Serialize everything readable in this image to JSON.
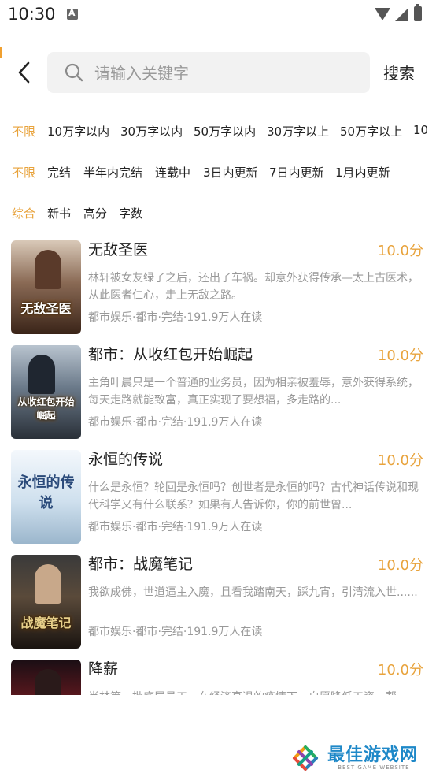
{
  "status_bar": {
    "time": "10:30"
  },
  "header": {
    "search_placeholder": "请输入关键字",
    "search_button": "搜索"
  },
  "filters": {
    "word_count": [
      "不限",
      "10万字以内",
      "30万字以内",
      "50万字以内",
      "30万字以上",
      "50万字以上",
      "10"
    ],
    "status": [
      "不限",
      "完结",
      "半年内完结",
      "连载中",
      "3日内更新",
      "7日内更新",
      "1月内更新"
    ],
    "sort": [
      "综合",
      "新书",
      "高分",
      "字数"
    ]
  },
  "accent_color": "#e8a33c",
  "books": [
    {
      "title": "无敌圣医",
      "score": "10.0分",
      "desc": "林轩被女友绿了之后，还出了车祸。却意外获得传承—太上古医术，从此医者仁心，走上无敌之路。",
      "meta": "都市娱乐·都市·完结·191.9万人在读",
      "cover_text": "无敌圣医"
    },
    {
      "title": "都市：从收红包开始崛起",
      "score": "10.0分",
      "desc": "主角叶晨只是一个普通的业务员，因为相亲被羞辱，意外获得系统，每天走路就能致富，真正实现了要想福，多走路的...",
      "meta": "都市娱乐·都市·完结·191.9万人在读",
      "cover_text": "从收红包开始崛起"
    },
    {
      "title": "永恒的传说",
      "score": "10.0分",
      "desc": "什么是永恒？轮回是永恒吗？创世者是永恒的吗？古代神话传说和现代科学又有什么联系？如果有人告诉你，你的前世曾...",
      "meta": "都市娱乐·都市·完结·191.9万人在读",
      "cover_text": "永恒的传说"
    },
    {
      "title": "都市：战魔笔记",
      "score": "10.0分",
      "desc": "我欲成佛，世道逼主入魔，且看我踏南天，踩九宵，引清流入世......",
      "meta": "都市娱乐·都市·完结·191.9万人在读",
      "cover_text": "战魔笔记"
    },
    {
      "title": "降薪",
      "score": "10.0分",
      "desc": "肖林等一批底层员工，在经济衰退的疫情下，自愿降低工资，帮",
      "meta": "",
      "cover_text": ""
    }
  ],
  "watermark": {
    "title": "最佳游戏网",
    "subtitle": "— BEST GAME WEBSITE —"
  }
}
